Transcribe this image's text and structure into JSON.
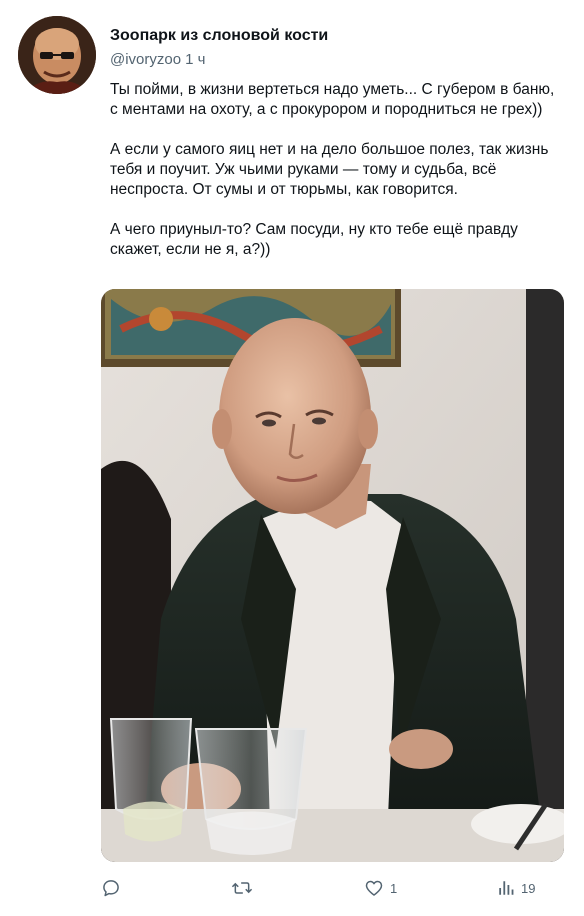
{
  "tweet": {
    "display_name": "Зоопарк из слоновой кости",
    "handle": "@ivoryzoo",
    "time": "1 ч",
    "paragraphs": [
      "Ты пойми, в жизни вертеться надо уметь... С губером в баню, с ментами на охоту, а с прокурором и породниться не грех))",
      "А если у самого яиц нет и на дело большое полез, так жизнь тебя и поучит. Уж чьими руками — тому и судьба, всё неспроста. От сумы и от тюрьмы, как говорится.",
      "А чего приуныл-то? Сам посуди, ну кто тебе ещё правду скажет, если не я, а?))"
    ]
  },
  "actions": {
    "reply": {
      "icon": "reply-icon",
      "count": ""
    },
    "retweet": {
      "icon": "retweet-icon",
      "count": ""
    },
    "like": {
      "icon": "heart-icon",
      "count": "1"
    },
    "views": {
      "icon": "views-icon",
      "count": "19"
    }
  },
  "colors": {
    "text": "#0f1419",
    "secondary": "#536471",
    "background": "#ffffff"
  }
}
